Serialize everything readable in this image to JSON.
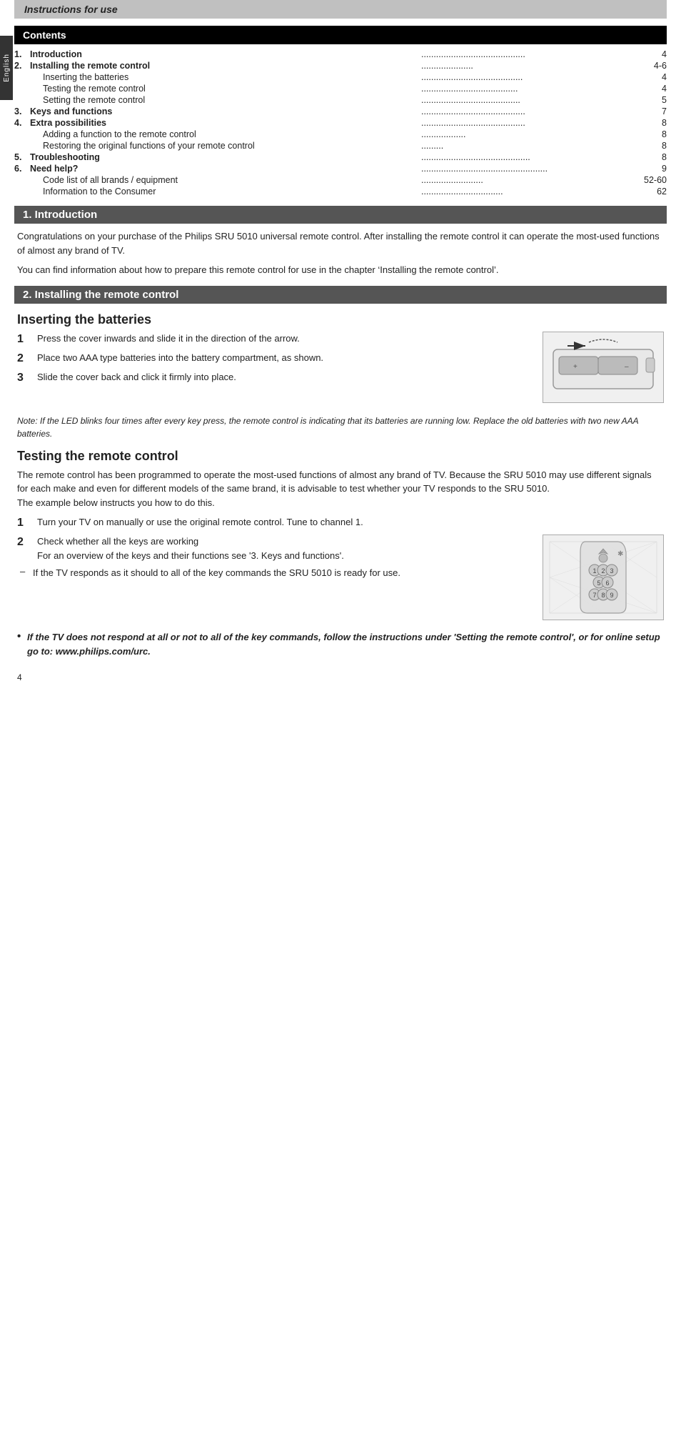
{
  "page": {
    "header": "Instructions for use",
    "side_tab": "English",
    "page_number": "4"
  },
  "contents": {
    "title": "Contents",
    "items": [
      {
        "num": "1.",
        "label": "Introduction",
        "bold": true,
        "dots": "..........................................",
        "page": "4"
      },
      {
        "num": "2.",
        "label": "Installing the remote control",
        "bold": true,
        "dots": "............................",
        "page": "4-6"
      },
      {
        "num": "",
        "label": "Inserting the batteries",
        "bold": false,
        "dots": ".......................................",
        "page": "4"
      },
      {
        "num": "",
        "label": "Testing the remote control",
        "bold": false,
        "dots": "....................................",
        "page": "4"
      },
      {
        "num": "",
        "label": "Setting the remote control",
        "bold": false,
        "dots": "....................................",
        "page": "5"
      },
      {
        "num": "3.",
        "label": "Keys and functions",
        "bold": true,
        "dots": ".........................................",
        "page": "7"
      },
      {
        "num": "4.",
        "label": "Extra possibilities",
        "bold": true,
        "dots": "..........................................",
        "page": "8"
      },
      {
        "num": "",
        "label": "Adding a function to the remote control",
        "bold": false,
        "dots": "...................",
        "page": "8"
      },
      {
        "num": "",
        "label": "Restoring the original functions of your remote control",
        "bold": false,
        "dots": ".........",
        "page": "8"
      },
      {
        "num": "5.",
        "label": "Troubleshooting",
        "bold": true,
        "dots": "...........................................",
        "page": "8"
      },
      {
        "num": "6.",
        "label": "Need help?",
        "bold": true,
        "dots": "..................................................",
        "page": "9"
      },
      {
        "num": "",
        "label": "Code list of all brands / equipment",
        "bold": false,
        "dots": ".........................",
        "page": "52-60"
      },
      {
        "num": "",
        "label": "Information to the Consumer",
        "bold": false,
        "dots": ".................................",
        "page": "62"
      }
    ]
  },
  "sections": {
    "intro": {
      "header": "1. Introduction",
      "body1": "Congratulations on your purchase of the Philips SRU 5010 universal remote control. After installing the remote control it can operate the most-used functions of almost any brand of TV.",
      "body2": "You can find information about how to prepare this remote control for use in the chapter ‘Installing the remote control’."
    },
    "installing": {
      "header": "2. Installing the remote control",
      "subsections": {
        "inserting": {
          "heading": "Inserting the batteries",
          "steps": [
            {
              "num": "1",
              "text": "Press the cover inwards and slide it in the direction of the arrow."
            },
            {
              "num": "2",
              "text": "Place two AAA type batteries into the battery compartment, as shown."
            },
            {
              "num": "3",
              "text": "Slide the cover back and click it firmly into place."
            }
          ],
          "note": "Note: If the LED blinks four times after every key press, the remote control is indicating that its batteries are running low. Replace the old batteries with two new AAA batteries."
        },
        "testing": {
          "heading": "Testing the remote control",
          "body": "The remote control has been programmed to operate the most-used functions of almost any brand of TV. Because the SRU 5010 may use different signals for each make and even for different models of the same brand, it is advisable to test whether your TV responds to the SRU 5010.\nThe example below instructs you how to do this.",
          "steps": [
            {
              "num": "1",
              "text": "Turn your TV on manually or use the original remote control. Tune to channel 1."
            },
            {
              "num": "2",
              "text": "Check whether all the keys are working\nFor an overview of the keys and their functions see ‘3. Keys and functions’."
            }
          ],
          "dash_item": "If the TV responds as it should to all of the key commands the SRU 5010 is ready for use.",
          "bullet": "If the TV does not respond at all or not to all of the key commands, follow the instructions under ‘Setting the remote control’, or for online setup go to: www.philips.com/urc."
        }
      }
    }
  }
}
